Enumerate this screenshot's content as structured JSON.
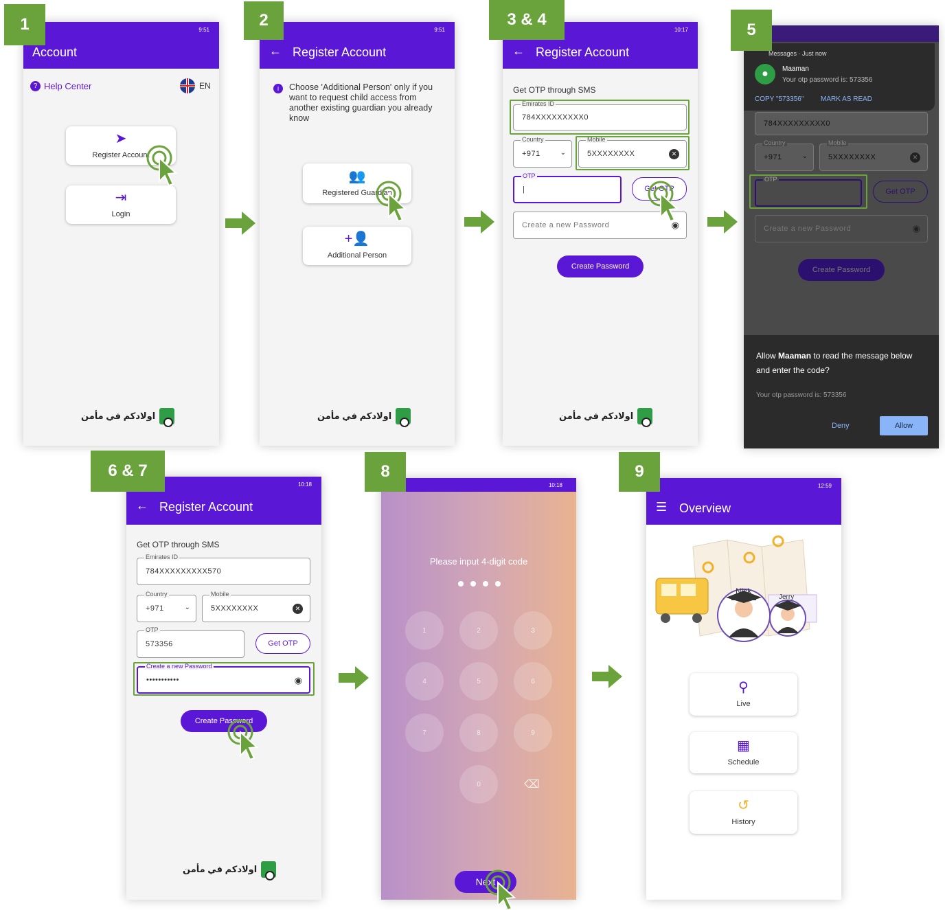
{
  "steps": [
    "1",
    "2",
    "3 & 4",
    "5",
    "6 & 7",
    "8",
    "9"
  ],
  "colors": {
    "primary": "#5b17d6",
    "step_green": "#6aa33b"
  },
  "status": {
    "s1": "9:51",
    "s2": "9:51",
    "s3": "10:17",
    "s6": "10:18",
    "s8": "10:18",
    "s9": "12:59"
  },
  "screen1": {
    "title": "Account",
    "help": "Help Center",
    "lang": "EN",
    "register": "Register Account",
    "login": "Login"
  },
  "screen2": {
    "title": "Register Account",
    "info": "Choose 'Additional Person' only if you want to request child access from another existing guardian you already know",
    "registered": "Registered Guardian",
    "additional": "Additional Person"
  },
  "screen3": {
    "title": "Register Account",
    "heading": "Get OTP through SMS",
    "eid_label": "Emirates ID",
    "eid_value": "784XXXXXXXXX0",
    "country_label": "Country",
    "country_value": "+971",
    "mobile_label": "Mobile",
    "mobile_value": "5XXXXXXXX",
    "otp_label": "OTP",
    "otp_value": "|",
    "get_otp": "Get OTP",
    "password_placeholder": "Create a new Password",
    "create": "Create Password"
  },
  "screen5": {
    "notif_app": "Messages",
    "notif_time": "Just now",
    "sender": "Maaman",
    "message": "Your otp password is: 573356",
    "copy": "COPY \"573356\"",
    "mark": "MARK AS READ",
    "eid_value": "784XXXXXXXXX0",
    "country_label": "Country",
    "country_value": "+971",
    "mobile_label": "Mobile",
    "mobile_value": "5XXXXXXXX",
    "otp_label": "OTP",
    "get_otp": "Get OTP",
    "password_placeholder": "Create a new Password",
    "create": "Create Password",
    "dialog_prefix": "Allow ",
    "dialog_app": "Maaman",
    "dialog_suffix": " to read the message below and enter the code?",
    "dialog_msg": "Your otp password is: 573356",
    "deny": "Deny",
    "allow": "Allow"
  },
  "screen6": {
    "title": "Register Account",
    "heading": "Get OTP through SMS",
    "eid_label": "Emirates ID",
    "eid_value": "784XXXXXXXXX570",
    "country_label": "Country",
    "country_value": "+971",
    "mobile_label": "Mobile",
    "mobile_value": "5XXXXXXXX",
    "otp_label": "OTP",
    "otp_value": "573356",
    "get_otp": "Get OTP",
    "password_label": "Create a new Password",
    "password_value": "•••••••••••",
    "create": "Create Password"
  },
  "screen8": {
    "prompt": "Please input 4-digit code",
    "keys": [
      "1",
      "2",
      "3",
      "4",
      "5",
      "6",
      "7",
      "8",
      "9",
      "0"
    ],
    "next": "Next"
  },
  "screen9": {
    "title": "Overview",
    "nick": "Nick",
    "jerry": "Jerry",
    "live": "Live",
    "schedule": "Schedule",
    "history": "History"
  },
  "logo": {
    "text": "اولادكم في مأمن"
  }
}
